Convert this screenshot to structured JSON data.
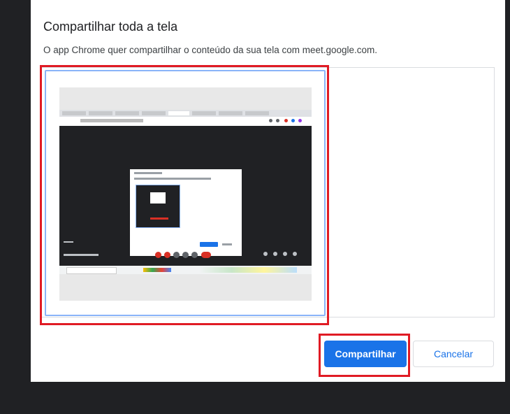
{
  "dialog": {
    "title": "Compartilhar toda a tela",
    "description": "O app Chrome quer compartilhar o conteúdo da sua tela com meet.google.com.",
    "share_label": "Compartilhar",
    "cancel_label": "Cancelar"
  },
  "colors": {
    "accent": "#1a73e8",
    "highlight": "#e01b24",
    "preview_border": "#8ab4f8",
    "backdrop": "#202124"
  },
  "icons": [
    "screen-preview-thumbnail"
  ]
}
